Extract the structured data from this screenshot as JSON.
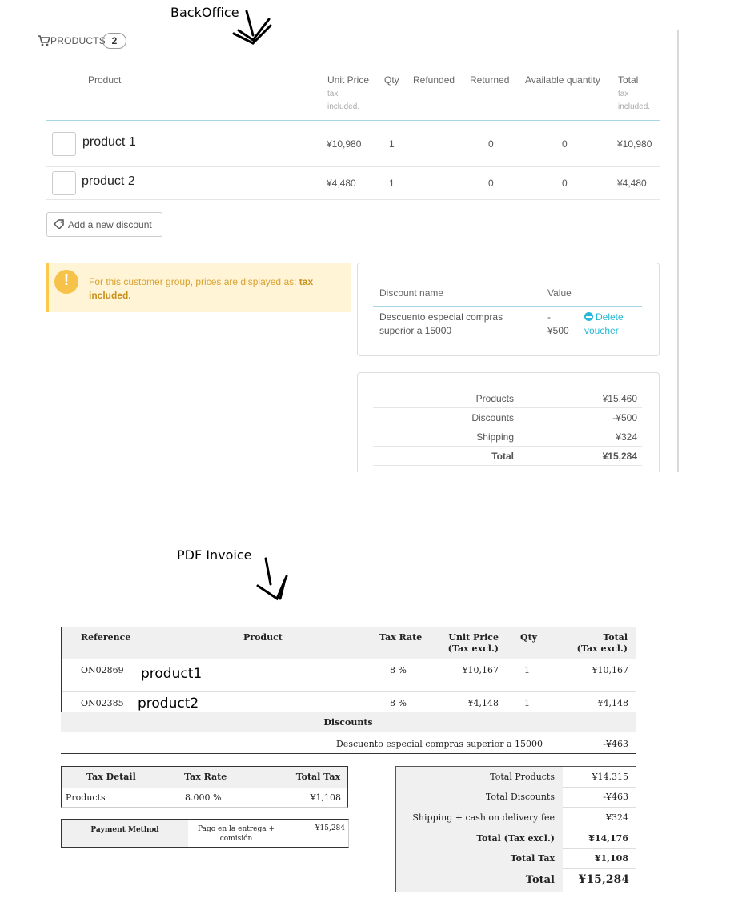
{
  "annotations": {
    "backoffice": "BackOffice",
    "pdf_invoice": "PDF Invoice"
  },
  "backoffice": {
    "heading": "PRODUCTS",
    "count": "2",
    "columns": {
      "product": "Product",
      "unit_price": "Unit Price",
      "unit_price_sub1": "tax",
      "unit_price_sub2": "included.",
      "qty": "Qty",
      "refunded": "Refunded",
      "returned": "Returned",
      "available": "Available quantity",
      "total": "Total",
      "total_sub1": "tax",
      "total_sub2": "included."
    },
    "products": [
      {
        "name": "product 1",
        "unit_price": "¥10,980",
        "qty": "1",
        "returned": "0",
        "available": "0",
        "total": "¥10,980"
      },
      {
        "name": "product 2",
        "unit_price": "¥4,480",
        "qty": "1",
        "returned": "0",
        "available": "0",
        "total": "¥4,480"
      }
    ],
    "add_discount_label": "Add a new discount",
    "alert": {
      "text": "For this customer group, prices are displayed as: ",
      "bold": "tax included."
    },
    "discounts": {
      "col_name": "Discount name",
      "col_value": "Value",
      "row": {
        "name_line1": "Descuento especial compras",
        "name_line2": "superior a 15000",
        "value_line1": "-",
        "value_line2": "¥500",
        "action_line1": "Delete",
        "action_line2": "voucher"
      }
    },
    "totals": [
      {
        "label": "Products",
        "value": "¥15,460"
      },
      {
        "label": "Discounts",
        "value": "-¥500"
      },
      {
        "label": "Shipping",
        "value": "¥324"
      },
      {
        "label": "Total",
        "value": "¥15,284"
      }
    ]
  },
  "invoice": {
    "columns": {
      "reference": "Reference",
      "product": "Product",
      "tax_rate": "Tax Rate",
      "unit_price_1": "Unit Price",
      "unit_price_2": "(Tax excl.)",
      "qty": "Qty",
      "total_1": "Total",
      "total_2": "(Tax excl.)"
    },
    "rows": [
      {
        "reference": "ON02869",
        "product": "product1",
        "tax_rate": "8 %",
        "unit_price": "¥10,167",
        "qty": "1",
        "total": "¥10,167"
      },
      {
        "reference": "ON02385",
        "product": "product2",
        "tax_rate": "8 %",
        "unit_price": "¥4,148",
        "qty": "1",
        "total": "¥4,148"
      }
    ],
    "discounts_header": "Discounts",
    "discount_row": {
      "name": "Descuento especial compras superior a 15000",
      "value": "-¥463"
    },
    "tax_detail": {
      "col_detail": "Tax Detail",
      "col_rate": "Tax Rate",
      "col_total": "Total Tax",
      "row": {
        "detail": "Products",
        "rate": "8.000 %",
        "total": "¥1,108"
      }
    },
    "payment": {
      "label": "Payment Method",
      "method_line1": "Pago en la entrega +",
      "method_line2": "comisión",
      "amount": "¥15,284"
    },
    "summary": [
      {
        "label": "Total Products",
        "value": "¥14,315"
      },
      {
        "label": "Total Discounts",
        "value": "-¥463"
      },
      {
        "label": "Shipping + cash on delivery fee",
        "value": "¥324"
      },
      {
        "label": "Total (Tax excl.)",
        "value": "¥14,176"
      },
      {
        "label": "Total Tax",
        "value": "¥1,108"
      },
      {
        "label": "Total",
        "value": "¥15,284"
      }
    ]
  }
}
